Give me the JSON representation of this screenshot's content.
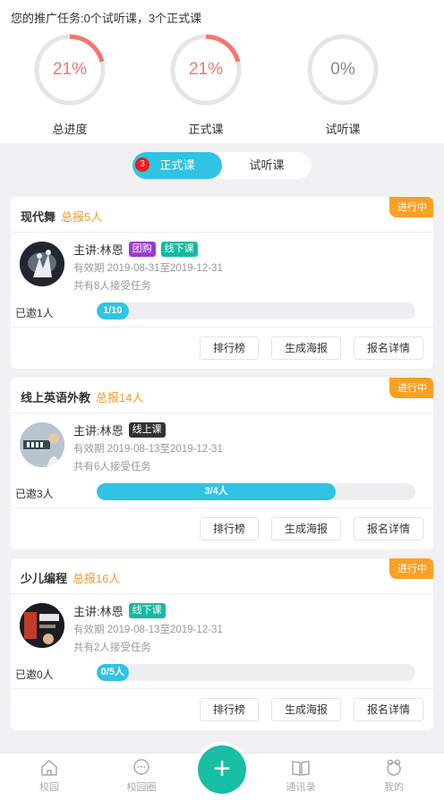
{
  "task_summary": "您的推广任务:0个试听课，3个正式课",
  "progress": [
    {
      "label": "总进度",
      "percent_text": "21%",
      "value": 0.21,
      "color": "#f4766c"
    },
    {
      "label": "正式课",
      "percent_text": "21%",
      "value": 0.21,
      "color": "#f4766c"
    },
    {
      "label": "试听课",
      "percent_text": "0%",
      "value": 0,
      "color": "#888888"
    }
  ],
  "segment": {
    "badge": "3",
    "tabs": [
      "正式课",
      "试听课"
    ],
    "active": 0
  },
  "courses": [
    {
      "title": "现代舞",
      "total": "总报5人",
      "status": "进行中",
      "teacher": "主讲:林恩",
      "tags": [
        {
          "text": "团购",
          "color": "purple"
        },
        {
          "text": "线下课",
          "color": "green"
        }
      ],
      "period": "有效期 2019-08-31至2019-12-31",
      "accepted": "共有8人接受任务",
      "invited": "已邀1人",
      "progress_text": "1/10",
      "progress_value": 0.1,
      "buttons": [
        "排行榜",
        "生成海报",
        "报名详情"
      ]
    },
    {
      "title": "线上英语外教",
      "total": "总报14人",
      "status": "进行中",
      "teacher": "主讲:林恩",
      "tags": [
        {
          "text": "线上课",
          "color": "dark"
        }
      ],
      "period": "有效期 2019-08-13至2019-12-31",
      "accepted": "共有6人接受任务",
      "invited": "已邀3人",
      "progress_text": "3/4人",
      "progress_value": 0.75,
      "buttons": [
        "排行榜",
        "生成海报",
        "报名详情"
      ]
    },
    {
      "title": "少儿编程",
      "total": "总报16人",
      "status": "进行中",
      "teacher": "主讲:林恩",
      "tags": [
        {
          "text": "线下课",
          "color": "green"
        }
      ],
      "period": "有效期 2019-08-13至2019-12-31",
      "accepted": "共有2人接受任务",
      "invited": "已邀0人",
      "progress_text": "0/5人",
      "progress_value": 0,
      "buttons": [
        "排行榜",
        "生成海报",
        "报名详情"
      ]
    }
  ],
  "tabbar": [
    {
      "label": "校园",
      "icon": "home-icon"
    },
    {
      "label": "校园圈",
      "icon": "chat-icon"
    },
    {
      "label": "",
      "icon": "plus-icon"
    },
    {
      "label": "通讯录",
      "icon": "book-icon"
    },
    {
      "label": "我的",
      "icon": "profile-icon"
    }
  ],
  "fab_symbol": "+"
}
